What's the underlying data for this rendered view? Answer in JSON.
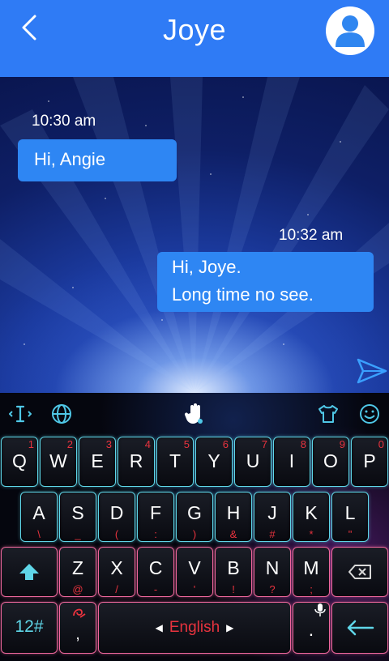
{
  "header": {
    "title": "Joye"
  },
  "messages": [
    {
      "time": "10:30 am",
      "lines": [
        "Hi, Angie"
      ],
      "side": "left"
    },
    {
      "time": "10:32 am",
      "lines": [
        "Hi, Joye.",
        "Long time no see."
      ],
      "side": "right"
    }
  ],
  "toolbar": {
    "icons": [
      "text-cursor-icon",
      "globe-icon",
      "hand-touch-icon",
      "shirt-icon",
      "smiley-icon"
    ]
  },
  "keyboard": {
    "row1": [
      {
        "key": "Q",
        "hint": "1"
      },
      {
        "key": "W",
        "hint": "2"
      },
      {
        "key": "E",
        "hint": "3"
      },
      {
        "key": "R",
        "hint": "4"
      },
      {
        "key": "T",
        "hint": "5"
      },
      {
        "key": "Y",
        "hint": "6"
      },
      {
        "key": "U",
        "hint": "7"
      },
      {
        "key": "I",
        "hint": "8"
      },
      {
        "key": "O",
        "hint": "9"
      },
      {
        "key": "P",
        "hint": "0"
      }
    ],
    "row2": [
      {
        "key": "A",
        "hint": "\\"
      },
      {
        "key": "S",
        "hint": "_"
      },
      {
        "key": "D",
        "hint": "("
      },
      {
        "key": "F",
        "hint": ":"
      },
      {
        "key": "G",
        "hint": ")"
      },
      {
        "key": "H",
        "hint": "&"
      },
      {
        "key": "J",
        "hint": "#"
      },
      {
        "key": "K",
        "hint": "*"
      },
      {
        "key": "L",
        "hint": "\""
      }
    ],
    "row3": [
      {
        "key": "Z",
        "hint": "@"
      },
      {
        "key": "X",
        "hint": "/"
      },
      {
        "key": "C",
        "hint": "-"
      },
      {
        "key": "V",
        "hint": "'"
      },
      {
        "key": "B",
        "hint": "!"
      },
      {
        "key": "N",
        "hint": "?"
      },
      {
        "key": "M",
        "hint": ";"
      }
    ],
    "numbers_label": "12#",
    "comma_label": ",",
    "space_label": "English",
    "period_label": ".",
    "accent_border": "#5fd6e8",
    "hint_color": "#e8333e"
  }
}
